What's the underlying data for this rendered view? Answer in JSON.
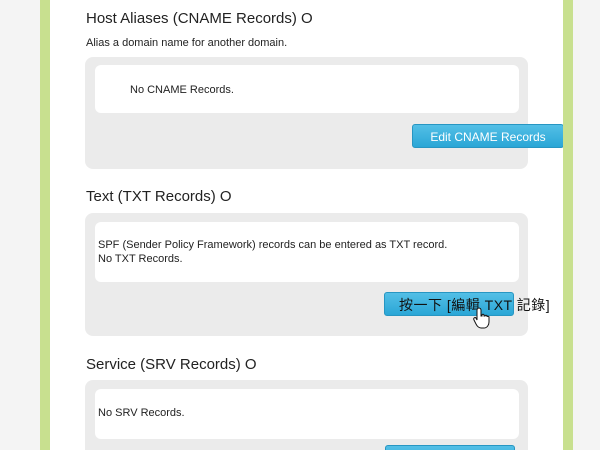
{
  "cname": {
    "title": "Host Aliases (CNAME Records) O",
    "description": "Alias a domain name for another domain.",
    "empty_text": "No CNAME Records.",
    "edit_button": "Edit CNAME Records"
  },
  "txt": {
    "title": "Text (TXT Records) O",
    "info_line": "SPF (Sender Policy Framework) records can be entered as TXT record.",
    "empty_text": "No TXT Records.",
    "edit_button_overlay": "按一下 [編輯 TXT 記錄]"
  },
  "srv": {
    "title": "Service (SRV Records) O",
    "empty_text": "No SRV Records."
  },
  "colors": {
    "accent_rail": "#c8e08f",
    "button_blue": "#2aa6d6",
    "panel_gray": "#ebebeb"
  }
}
